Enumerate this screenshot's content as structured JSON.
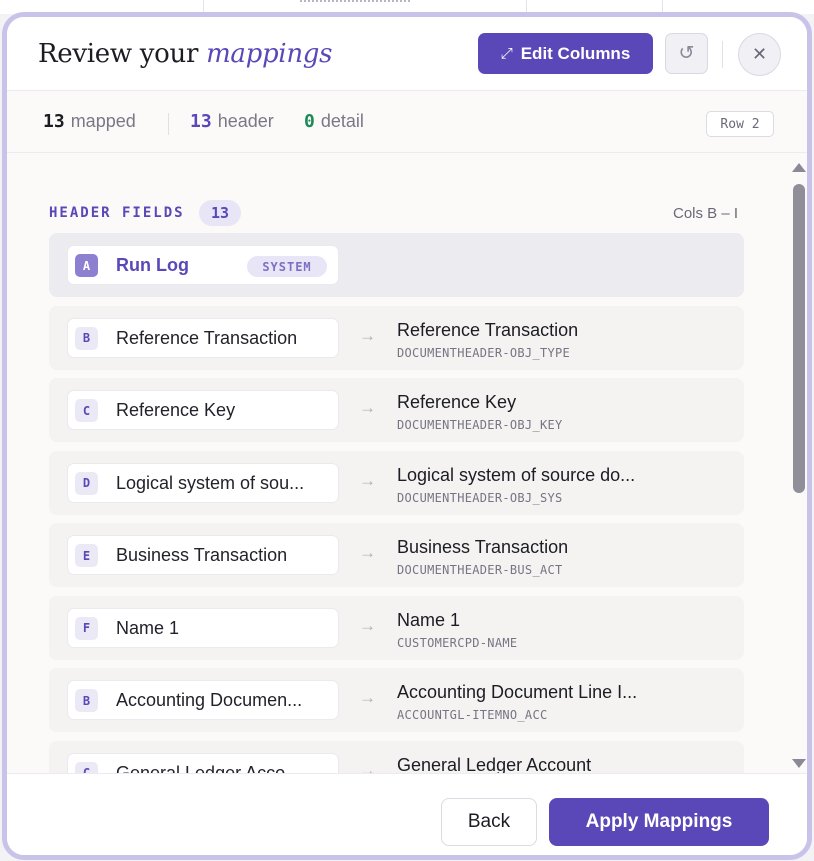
{
  "modal": {
    "title_plain": "Review your ",
    "title_accent": "mappings",
    "edit_columns_label": "Edit Columns",
    "edit_columns_icon": "expand-arrows-icon",
    "reset_icon": "undo-icon",
    "close_icon": "close-icon"
  },
  "stats": {
    "mapped_count": "13",
    "mapped_label": "mapped",
    "header_count": "13",
    "header_label": "header",
    "detail_count": "0",
    "detail_label": "detail",
    "row_chip": "Row 2"
  },
  "section": {
    "label": "HEADER FIELDS",
    "count": "13",
    "cols_range": "Cols B – I"
  },
  "rows": [
    {
      "letter": "A",
      "source": "Run Log",
      "badge": "SYSTEM",
      "system": true
    },
    {
      "letter": "B",
      "source": "Reference Transaction",
      "target": "Reference Transaction",
      "code": "DOCUMENTHEADER-OBJ_TYPE"
    },
    {
      "letter": "C",
      "source": "Reference Key",
      "target": "Reference Key",
      "code": "DOCUMENTHEADER-OBJ_KEY"
    },
    {
      "letter": "D",
      "source": "Logical system of sou...",
      "target": "Logical system of source do...",
      "code": "DOCUMENTHEADER-OBJ_SYS"
    },
    {
      "letter": "E",
      "source": "Business Transaction",
      "target": "Business Transaction",
      "code": "DOCUMENTHEADER-BUS_ACT"
    },
    {
      "letter": "F",
      "source": "Name 1",
      "target": "Name 1",
      "code": "CUSTOMERCPD-NAME"
    },
    {
      "letter": "B",
      "source": "Accounting Documen...",
      "target": "Accounting Document Line I...",
      "code": "ACCOUNTGL-ITEMNO_ACC"
    },
    {
      "letter": "C",
      "source": "General Ledger Acco...",
      "target": "General Ledger Account",
      "code": ""
    }
  ],
  "footer": {
    "back_label": "Back",
    "apply_label": "Apply Mappings"
  },
  "colors": {
    "accent": "#5a47b8",
    "detail_green": "#1e8a5a",
    "modal_border": "#c9c3ea"
  }
}
